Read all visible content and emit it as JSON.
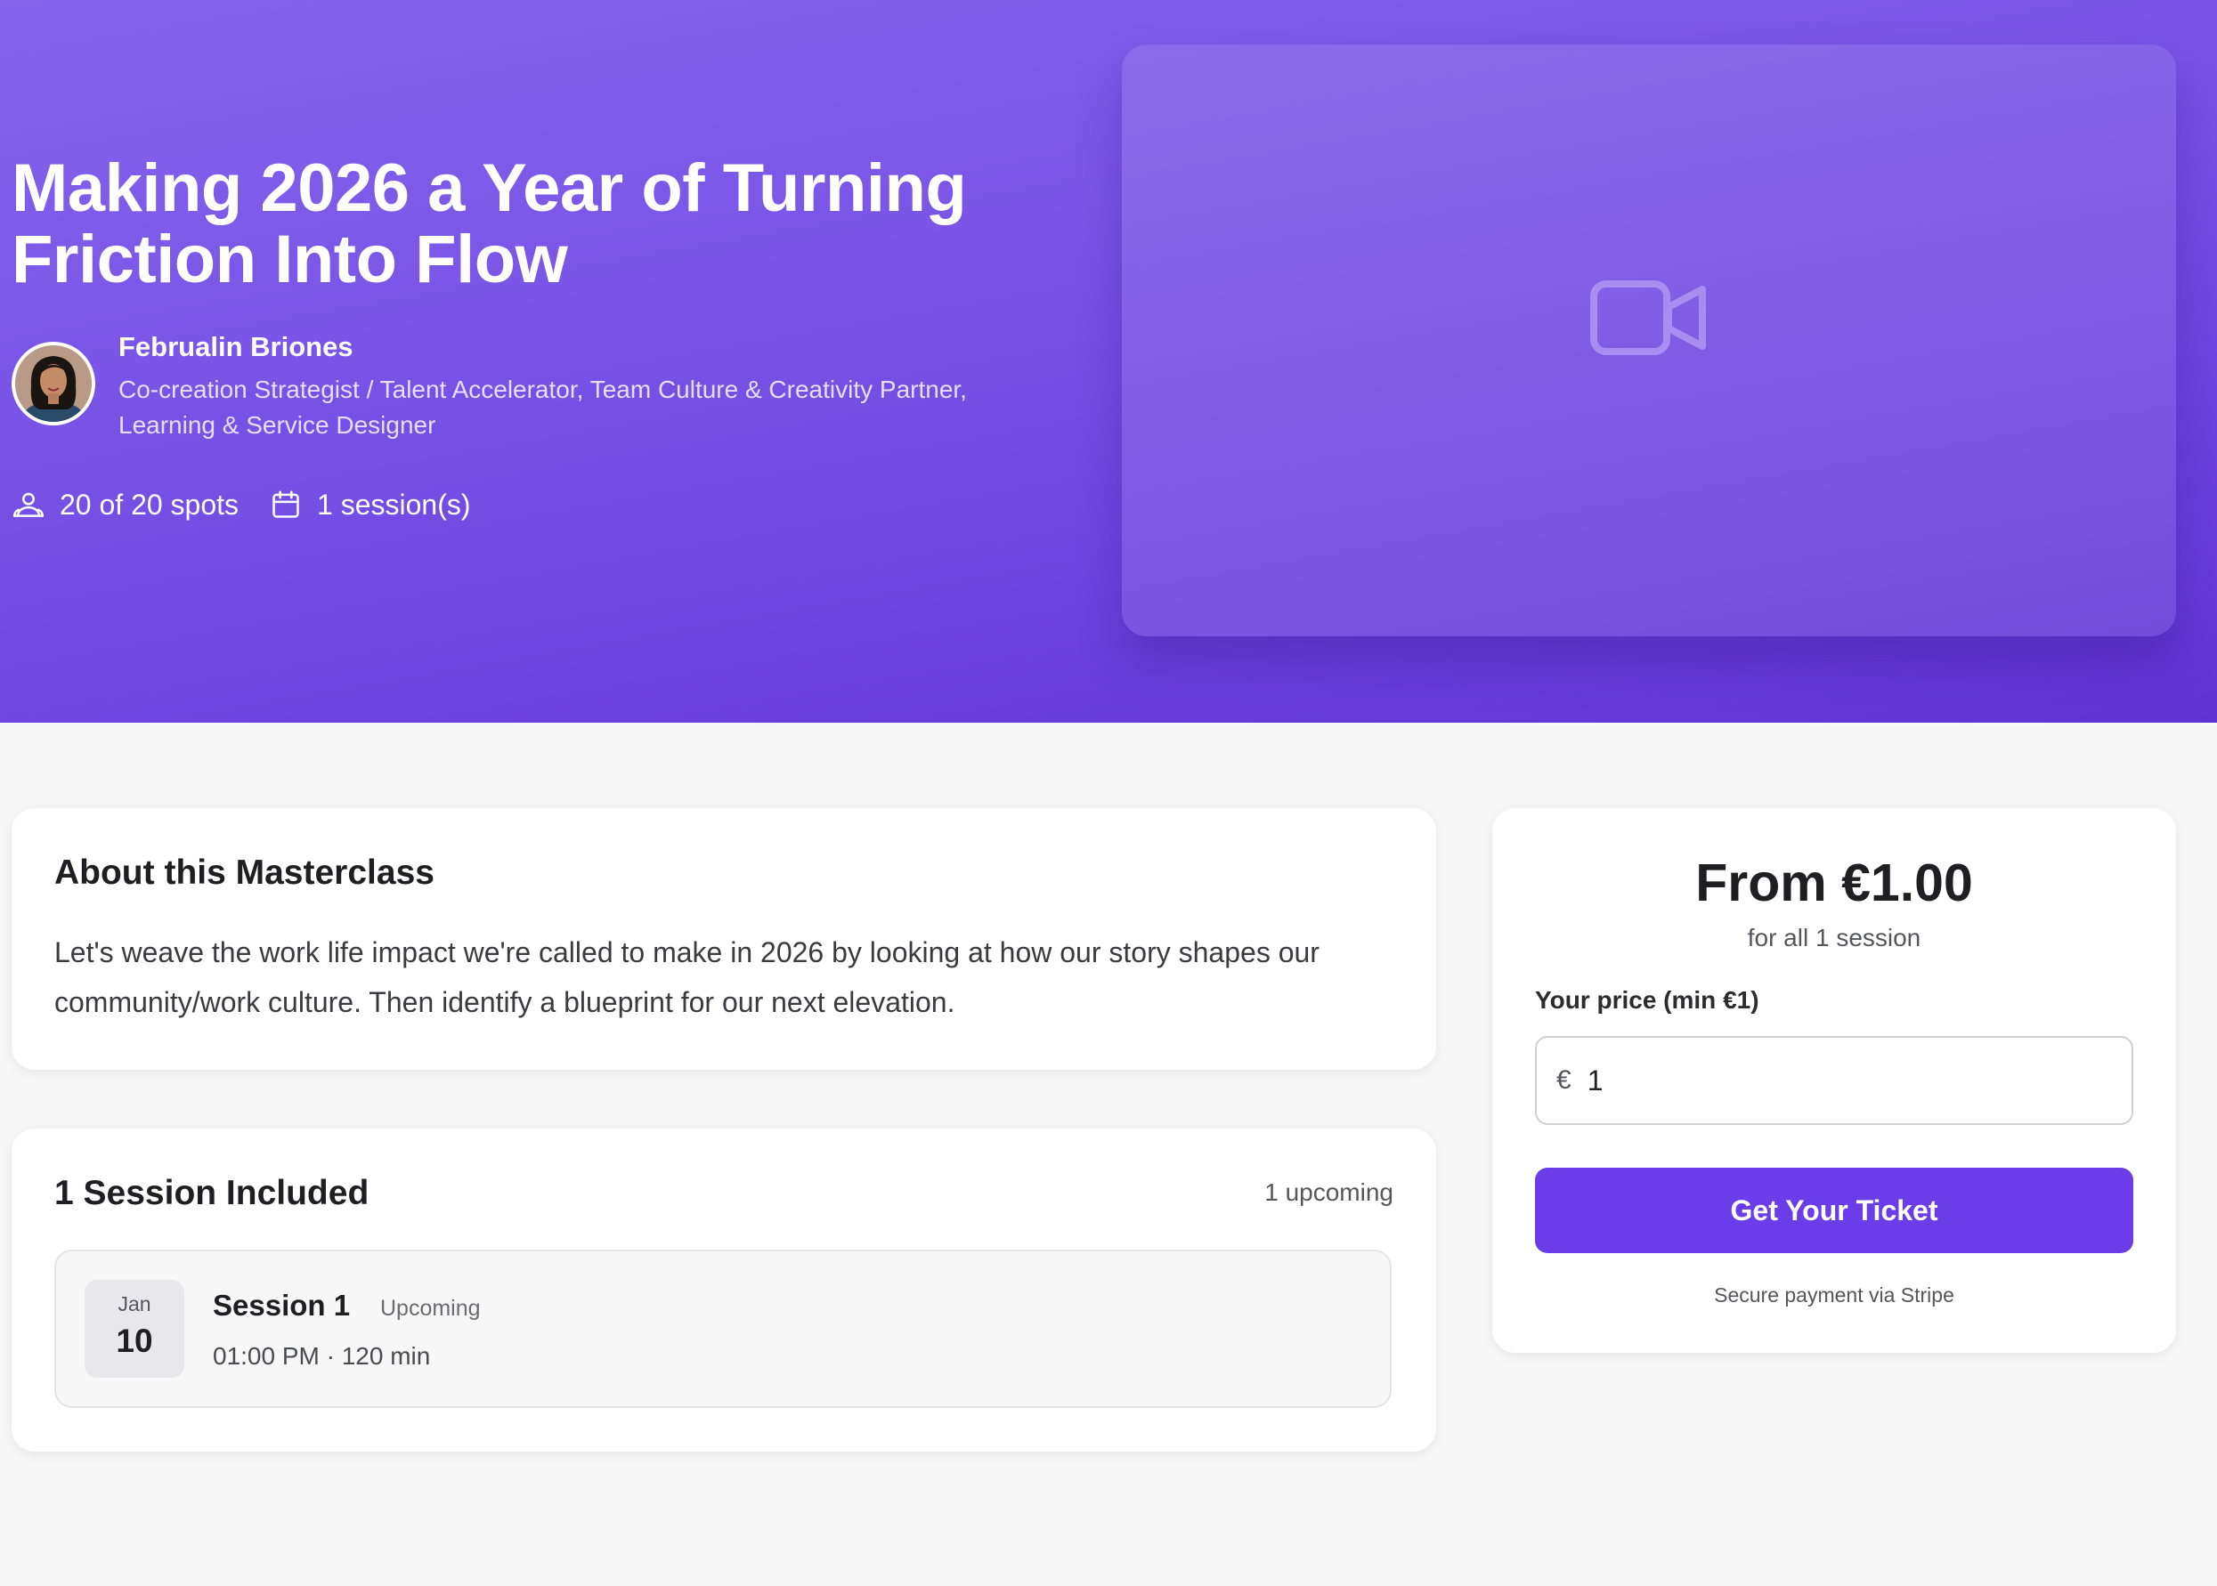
{
  "hero": {
    "title": "Making 2026 a Year of Turning Friction Into Flow",
    "host": {
      "name": "Februalin Briones",
      "role": "Co-creation Strategist / Talent Accelerator, Team Culture & Creativity Partner, Learning & Service Designer"
    },
    "stats": {
      "spots": "20 of 20 spots",
      "sessions": "1 session(s)"
    },
    "icons": {
      "spots": "users-icon",
      "sessions": "calendar-icon",
      "video": "video-camera-icon"
    }
  },
  "about": {
    "heading": "About this Masterclass",
    "text": "Let's weave the work life impact we're called to make in 2026 by looking at how our story shapes our community/work culture. Then identify a blueprint for our next elevation."
  },
  "sessions": {
    "heading": "1 Session Included",
    "upcoming_count": "1 upcoming",
    "items": [
      {
        "month": "Jan",
        "day": "10",
        "title": "Session 1",
        "status": "Upcoming",
        "time": "01:00 PM · 120 min"
      }
    ]
  },
  "pricing": {
    "price": "From €1.00",
    "subtitle": "for all 1 session",
    "input_label": "Your price (min €1)",
    "currency_symbol": "€",
    "input_value": "1",
    "button_label": "Get Your Ticket",
    "secure_note": "Secure payment via Stripe"
  },
  "colors": {
    "hero_gradient_start": "#8565ec",
    "hero_gradient_end": "#5f33d2",
    "accent": "#6a3de8",
    "page_background": "#f7f7f7"
  }
}
